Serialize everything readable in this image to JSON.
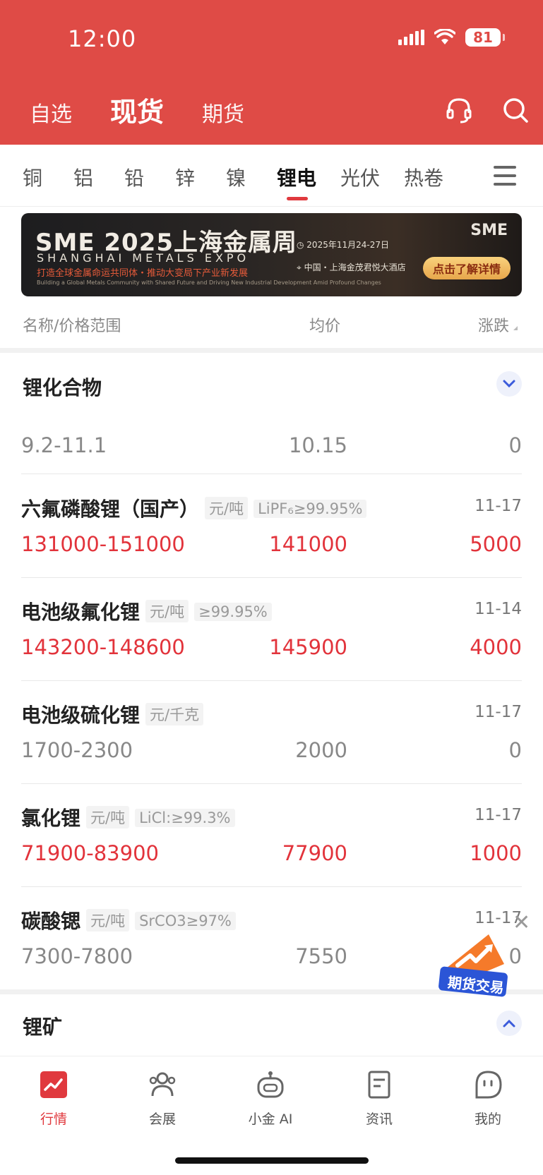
{
  "status_bar": {
    "time": "12:00",
    "battery": "81"
  },
  "header": {
    "tabs": [
      {
        "label": "自选"
      },
      {
        "label": "现货"
      },
      {
        "label": "期货"
      }
    ],
    "active_tab": "现货",
    "icons": [
      "headset-icon",
      "search-icon"
    ]
  },
  "category_tabs": {
    "items": [
      "铜",
      "铝",
      "铅",
      "锌",
      "镍",
      "锂电",
      "光伏",
      "热卷"
    ],
    "active": "锂电"
  },
  "banner": {
    "title": "SME 2025上海金属周",
    "subtitle": "SHANGHAI METALS EXPO",
    "slogan": "打造全球金属命运共同体・推动大变局下产业新发展",
    "tagline": "Building a Global Metals Community with Shared Future and Driving New Industrial Development Amid Profound Changes",
    "date": "2025年11月24-27日",
    "location": "中国・上海金茂君悦大酒店",
    "logo": "SME",
    "button": "点击了解详情"
  },
  "columns": {
    "name": "名称/价格范围",
    "avg": "均价",
    "change": "涨跌"
  },
  "sections": [
    {
      "title": "锂化合物",
      "expanded": true,
      "rows": [
        {
          "name": "",
          "unit": "",
          "spec": "",
          "date": "",
          "range": "9.2-11.1",
          "avg": "10.15",
          "change": "0",
          "up": false
        },
        {
          "name": "六氟磷酸锂（国产）",
          "unit": "元/吨",
          "spec": "LiPF₆≥99.95%",
          "date": "11-17",
          "range": "131000-151000",
          "avg": "141000",
          "change": "5000",
          "up": true
        },
        {
          "name": "电池级氟化锂",
          "unit": "元/吨",
          "spec": "≥99.95%",
          "date": "11-14",
          "range": "143200-148600",
          "avg": "145900",
          "change": "4000",
          "up": true
        },
        {
          "name": "电池级硫化锂",
          "unit": "元/千克",
          "spec": "",
          "date": "11-17",
          "range": "1700-2300",
          "avg": "2000",
          "change": "0",
          "up": false
        },
        {
          "name": "氯化锂",
          "unit": "元/吨",
          "spec": "LiCl:≥99.3%",
          "date": "11-17",
          "range": "71900-83900",
          "avg": "77900",
          "change": "1000",
          "up": true
        },
        {
          "name": "碳酸锶",
          "unit": "元/吨",
          "spec": "SrCO3≥97%",
          "date": "11-17",
          "range": "7300-7800",
          "avg": "7550",
          "change": "0",
          "up": false
        }
      ]
    },
    {
      "title": "锂矿",
      "expanded": false,
      "rows": []
    }
  ],
  "float_promo": {
    "label": "期货交易"
  },
  "bottom_nav": {
    "items": [
      {
        "label": "行情",
        "icon": "market-chart-icon"
      },
      {
        "label": "会展",
        "icon": "people-icon"
      },
      {
        "label": "小金 AI",
        "icon": "robot-icon"
      },
      {
        "label": "资讯",
        "icon": "news-icon"
      },
      {
        "label": "我的",
        "icon": "profile-icon"
      }
    ],
    "active": "行情"
  },
  "colors": {
    "header_red": "#df4b46",
    "up_red": "#e2333b",
    "accent_blue": "#3b5bdb"
  }
}
